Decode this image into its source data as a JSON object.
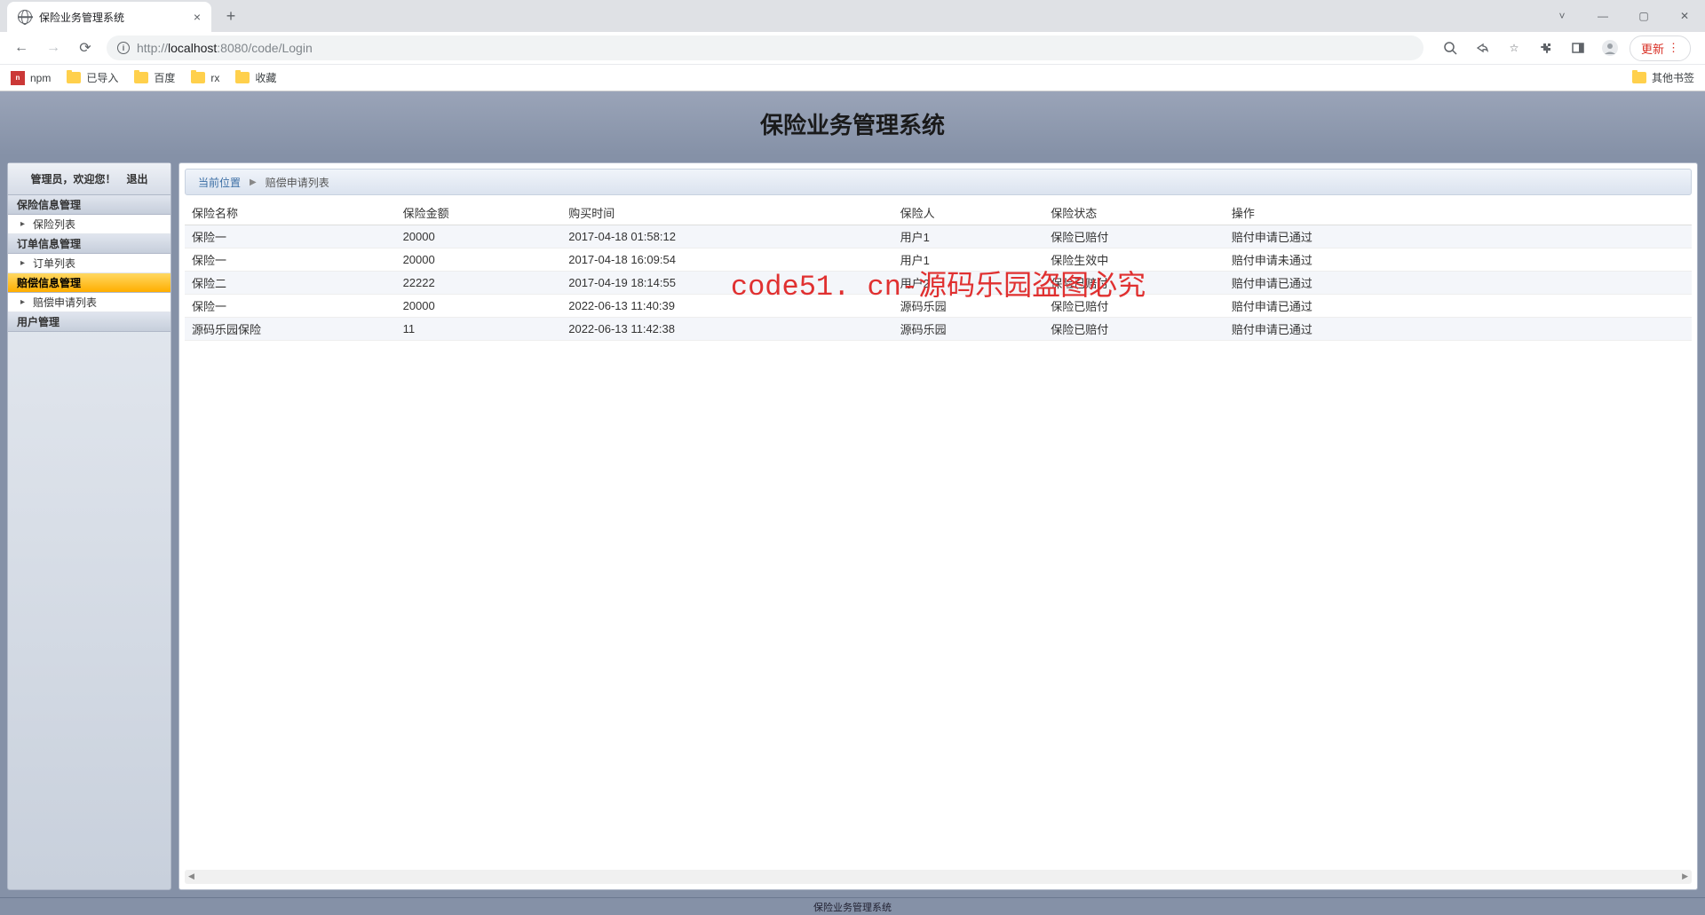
{
  "browser": {
    "tab_title": "保险业务管理系统",
    "url_host": "localhost",
    "url_port": ":8080",
    "url_path": "/code/Login",
    "url_scheme": "http://",
    "update_label": "更新",
    "bookmarks": {
      "npm": "npm",
      "imported": "已导入",
      "baidu": "百度",
      "rx": "rx",
      "fav": "收藏",
      "other": "其他书签"
    }
  },
  "page": {
    "title": "保险业务管理系统",
    "footer": "保险业务管理系统"
  },
  "sidebar": {
    "welcome": "管理员，欢迎您！",
    "logout": "退出",
    "cat_insurance": "保险信息管理",
    "item_insurance_list": "保险列表",
    "cat_order": "订单信息管理",
    "item_order_list": "订单列表",
    "cat_claim": "赔偿信息管理",
    "item_claim_list": "赔偿申请列表",
    "cat_user": "用户管理"
  },
  "breadcrumb": {
    "label": "当前位置",
    "current": "赔偿申请列表"
  },
  "table": {
    "headers": {
      "name": "保险名称",
      "amount": "保险金额",
      "buy_time": "购买时间",
      "insured": "保险人",
      "status": "保险状态",
      "action": "操作"
    },
    "rows": [
      {
        "name": "保险一",
        "amount": "20000",
        "buy_time": "2017-04-18 01:58:12",
        "insured": "用户1",
        "status": "保险已赔付",
        "action": "赔付申请已通过"
      },
      {
        "name": "保险一",
        "amount": "20000",
        "buy_time": "2017-04-18 16:09:54",
        "insured": "用户1",
        "status": "保险生效中",
        "action": "赔付申请未通过"
      },
      {
        "name": "保险二",
        "amount": "22222",
        "buy_time": "2017-04-19 18:14:55",
        "insured": "用户2",
        "status": "保险已赔付",
        "action": "赔付申请已通过"
      },
      {
        "name": "保险一",
        "amount": "20000",
        "buy_time": "2022-06-13 11:40:39",
        "insured": "源码乐园",
        "status": "保险已赔付",
        "action": "赔付申请已通过"
      },
      {
        "name": "源码乐园保险",
        "amount": "11",
        "buy_time": "2022-06-13 11:42:38",
        "insured": "源码乐园",
        "status": "保险已赔付",
        "action": "赔付申请已通过"
      }
    ]
  },
  "watermark": "code51. cn-源码乐园盗图必究"
}
